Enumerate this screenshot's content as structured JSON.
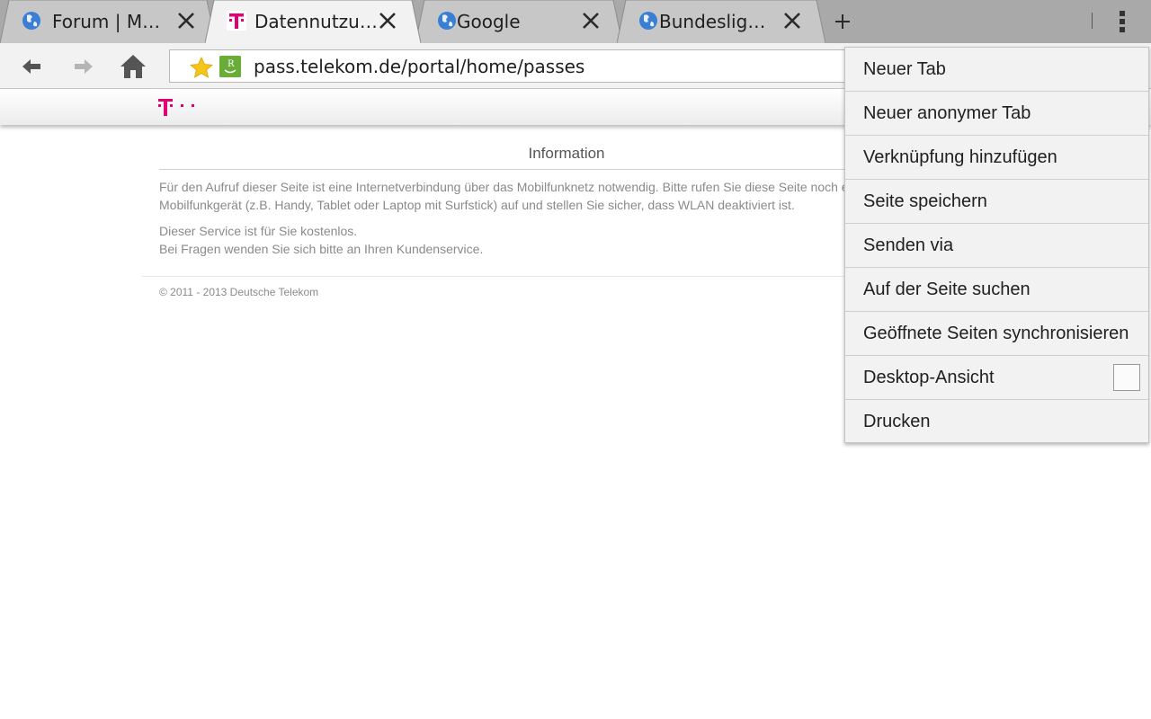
{
  "tabs": [
    {
      "title": "Forum | MD…",
      "favicon": "globe-icon",
      "active": false
    },
    {
      "title": "Datennutzung",
      "favicon": "telekom-t-icon",
      "active": true
    },
    {
      "title": "Google",
      "favicon": "globe-icon",
      "active": false
    },
    {
      "title": "Bundesligen…",
      "favicon": "globe-icon",
      "active": false
    }
  ],
  "toolbar": {
    "url": "pass.telekom.de/portal/home/passes",
    "back_icon": "back-arrow-icon",
    "forward_icon": "forward-arrow-icon",
    "home_icon": "home-icon"
  },
  "page": {
    "title": "Information",
    "paragraph1_line1": "Für den Aufruf dieser Seite ist eine Internetverbindung über das Mobilfunknetz notwendig. Bitte rufen Sie diese Seite noch ei",
    "paragraph1_line2": "Mobilfunkgerät (z.B. Handy, Tablet oder Laptop mit Surfstick) auf und stellen Sie sicher, dass WLAN deaktiviert ist.",
    "paragraph2_line1": "Dieser Service ist für Sie kostenlos.",
    "paragraph2_line2": "Bei Fragen wenden Sie sich bitte an Ihren Kundenservice.",
    "copyright": "© 2011 - 2013 Deutsche Telekom"
  },
  "menu": {
    "items": [
      {
        "label": "Neuer Tab"
      },
      {
        "label": "Neuer anonymer Tab"
      },
      {
        "label": "Verknüpfung hinzufügen"
      },
      {
        "label": "Seite speichern"
      },
      {
        "label": "Senden via"
      },
      {
        "label": "Auf der Seite suchen"
      },
      {
        "label": "Geöffnete Seiten synchronisieren"
      },
      {
        "label": "Desktop-Ansicht",
        "checked": false
      },
      {
        "label": "Drucken"
      }
    ]
  },
  "colors": {
    "brand_magenta": "#e20074",
    "star_yellow": "#f5c518",
    "reader_green": "#6aac38"
  }
}
